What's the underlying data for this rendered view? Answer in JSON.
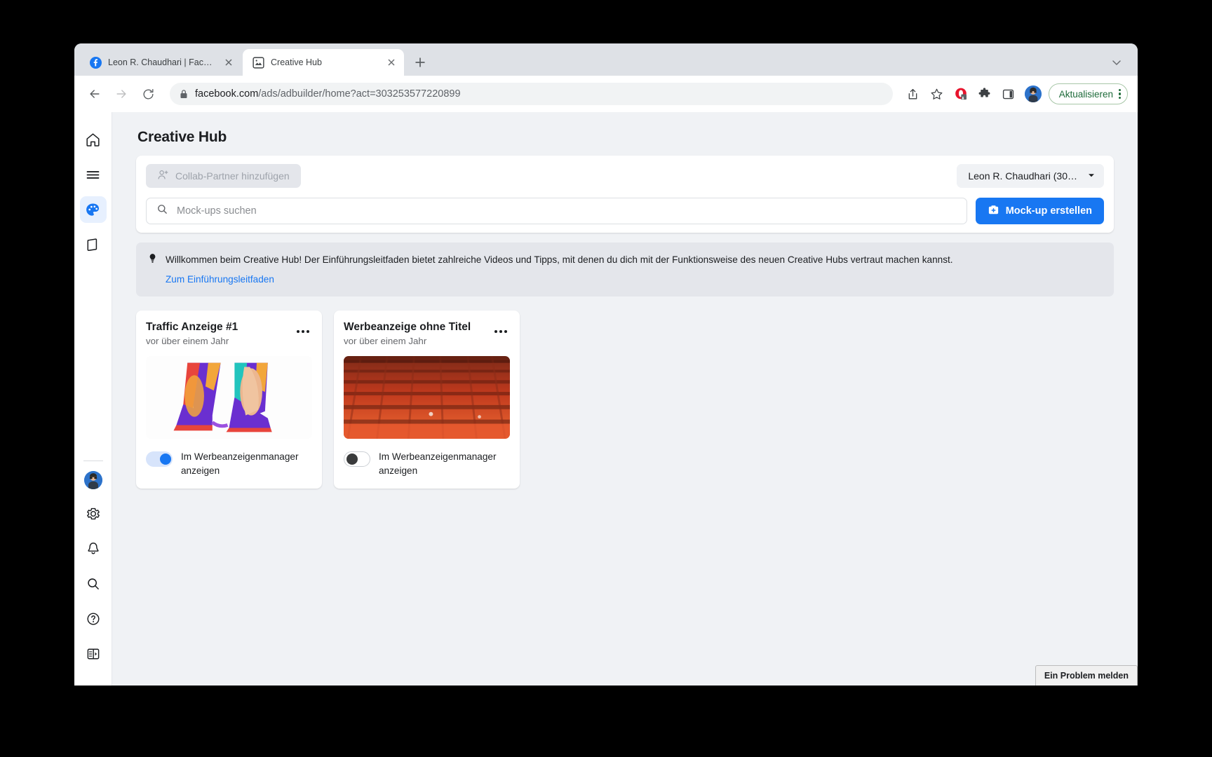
{
  "browser": {
    "tabs": [
      {
        "title": "Leon R. Chaudhari | Facebook",
        "favicon": "facebook-icon",
        "active": false
      },
      {
        "title": "Creative Hub",
        "favicon": "creative-hub-icon",
        "active": true
      }
    ],
    "new_tab_label": "+",
    "toolbar": {
      "back": "back-arrow-icon",
      "forward": "forward-arrow-icon",
      "reload": "reload-icon",
      "url_prefix": "facebook.com",
      "url_suffix": "/ads/adbuilder/home?act=303253577220899",
      "url_full": "facebook.com/ads/adbuilder/home?act=303253577220899",
      "update_label": "Aktualisieren",
      "icons": [
        "share-icon",
        "bookmark-star-icon",
        "opera-extension-icon",
        "puzzle-extension-icon",
        "side-panel-icon",
        "profile-avatar"
      ]
    }
  },
  "rail": {
    "top_items": [
      {
        "name": "home-icon",
        "active": false
      },
      {
        "name": "menu-icon",
        "active": false
      },
      {
        "name": "palette-icon",
        "active": true
      },
      {
        "name": "book-icon",
        "active": false
      }
    ],
    "bottom_items": [
      {
        "name": "profile-avatar"
      },
      {
        "name": "gear-icon"
      },
      {
        "name": "bell-icon"
      },
      {
        "name": "search-icon"
      },
      {
        "name": "help-circle-icon"
      },
      {
        "name": "panel-toggle-icon"
      }
    ]
  },
  "main": {
    "page_title": "Creative Hub",
    "collab_button": "Collab-Partner hinzufügen",
    "account_select": "Leon R. Chaudhari (30…",
    "search_placeholder": "Mock-ups suchen",
    "create_button": "Mock-up erstellen",
    "notice": {
      "icon": "lightbulb-icon",
      "text": "Willkommen beim Creative Hub! Der Einführungsleitfaden bietet zahlreiche Videos und Tipps, mit denen du dich mit der Funktionsweise des neuen Creative Hubs vertraut machen kannst.",
      "link": "Zum Einführungsleitfaden"
    },
    "cards": [
      {
        "title": "Traffic Anzeige #1",
        "subtitle": "vor über einem Jahr",
        "toggle_label": "Im Werbeanzeigenmanager anzeigen",
        "toggle_on": true,
        "thumb": "colorful-high-heels-illustration"
      },
      {
        "title": "Werbeanzeige ohne Titel",
        "subtitle": "vor über einem Jahr",
        "toggle_label": "Im Werbeanzeigenmanager anzeigen",
        "toggle_on": false,
        "thumb": "red-stadium-seats-photo"
      }
    ],
    "report_button": "Ein Problem melden"
  },
  "colors": {
    "accent": "#1877f2",
    "page_bg": "#f0f2f5",
    "notice_bg": "#e4e6eb",
    "update_green": "#1e6b3a"
  }
}
